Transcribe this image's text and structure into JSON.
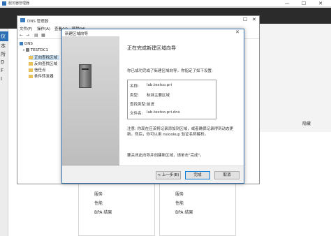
{
  "server_manager": {
    "title": "服务器管理器",
    "left_labels": [
      "仪",
      "本",
      "所",
      "D",
      "F",
      "I"
    ],
    "hide_label": "隐藏",
    "tiles": [
      {
        "items": [
          "服务",
          "性能",
          "BPA 结果"
        ]
      },
      {
        "items": [
          "服务",
          "性能",
          "BPA 结果"
        ]
      }
    ]
  },
  "dns_manager": {
    "title": "DNS 管理器",
    "menu": [
      "文件(F)",
      "操作(A)",
      "查看(V)",
      "帮助(H)"
    ],
    "tree": {
      "root": "DNS",
      "server": "TESTDC1",
      "children": [
        "正向查找区域",
        "反向查找区域",
        "信任点",
        "条件转发器"
      ]
    }
  },
  "wizard": {
    "title": "新建区域向导",
    "heading": "正在完成新建区域向导",
    "intro": "你已成功完成了新建区域向导。你指定了如下设置:",
    "summary": [
      {
        "label": "名称:",
        "value": "lab.testco.pri"
      },
      {
        "label": "类型:",
        "value": "标准主要区域"
      },
      {
        "label": "查找类型:",
        "value": "前进"
      },
      {
        "label": "文件名:",
        "value": "lab.testco.pri.dns"
      }
    ],
    "note": "注意: 你现在应该将记录添加到区域，或者确保记录得到动态更新。然后，你可以用 nslookup 验证名称解析。",
    "finish_text": "要关闭此向导并创建新区域，请单击\"完成\"。",
    "buttons": {
      "back": "< 上一步(B)",
      "finish": "完成",
      "cancel": "取消"
    }
  }
}
